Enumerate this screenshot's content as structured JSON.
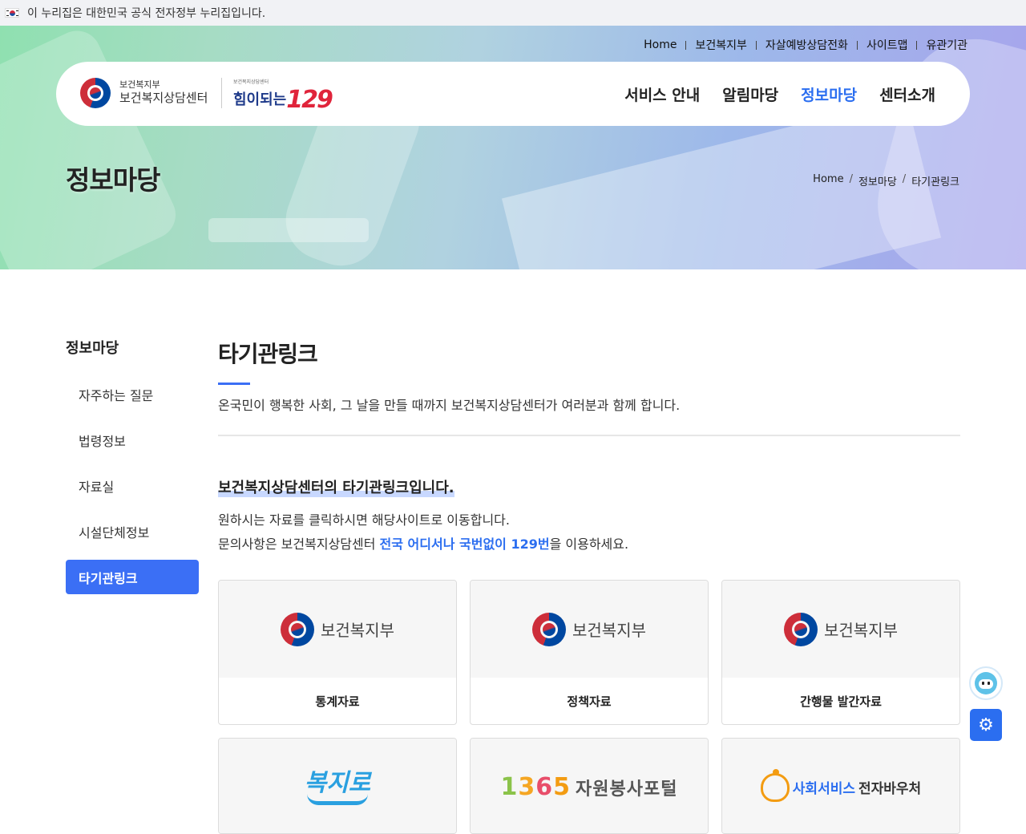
{
  "gov_banner": {
    "text": "이 누리집은 대한민국 공식 전자정부 누리집입니다."
  },
  "util_nav": [
    "Home",
    "보건복지부",
    "자살예방상담전화",
    "사이트맵",
    "유관기관"
  ],
  "logo": {
    "ministry": "보건복지부",
    "center": "보건복지상담센터",
    "tiny": "보건복지상담센터",
    "slogan": "힘이되는",
    "number": "129"
  },
  "gnb": [
    "서비스 안내",
    "알림마당",
    "정보마당",
    "센터소개"
  ],
  "hero": {
    "title": "정보마당"
  },
  "breadcrumb": [
    "Home",
    "정보마당",
    "타기관링크"
  ],
  "sidebar": {
    "title": "정보마당",
    "items": [
      "자주하는 질문",
      "법령정보",
      "자료실",
      "시설단체정보",
      "타기관링크"
    ]
  },
  "content": {
    "title": "타기관링크",
    "lead": "온국민이 행복한 사회, 그 날을 만들 때까지 보건복지상담센터가 여러분과 함께 합니다.",
    "sub_title": "보건복지상담센터의 타기관링크입니다.",
    "desc1": "원하시는 자료를 클릭하시면 해당사이트로 이동합니다.",
    "desc2_pre": "문의사항은 보건복지상담센터 ",
    "desc2_highlight": "전국 어디서나 국번없이 129번",
    "desc2_post": "을 이용하세요."
  },
  "cards": [
    {
      "logo": "보건복지부",
      "label": "통계자료"
    },
    {
      "logo": "보건복지부",
      "label": "정책자료"
    },
    {
      "logo": "보건복지부",
      "label": "간행물 발간자료"
    },
    {
      "logo": "복지로",
      "label": ""
    },
    {
      "logo": "1365 자원봉사포털",
      "label": ""
    },
    {
      "logo_a": "사회서비스",
      "logo_b": "전자바우처",
      "label": ""
    }
  ],
  "volunteer": {
    "d1": "1",
    "d2": "3",
    "d3": "6",
    "d4": "5",
    "kr": "자원봉사포털"
  },
  "colors": {
    "accent": "#3b6ff5",
    "link": "#2b6ef0"
  },
  "icons": {
    "chatbot": "chatbot-icon",
    "settings": "gear-icon"
  }
}
